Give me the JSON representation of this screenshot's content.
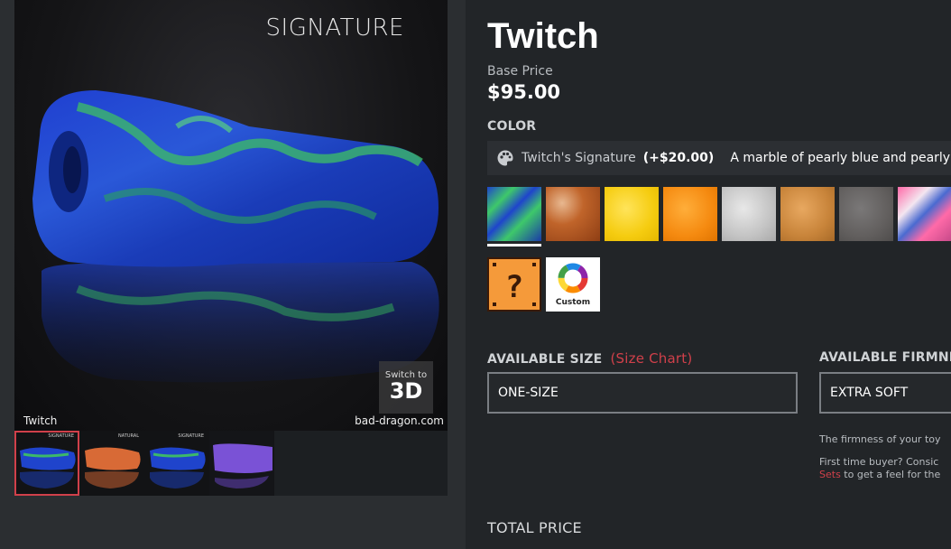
{
  "product": {
    "name": "Twitch",
    "base_price_label": "Base Price",
    "base_price": "$95.00"
  },
  "gallery": {
    "main_overlay_label": "SIGNATURE",
    "product_caption": "Twitch",
    "site_caption": "bad-dragon.com",
    "switch_small": "Switch to",
    "switch_big": "3D",
    "thumbnails": [
      {
        "label": "SIGNATURE",
        "active": true
      },
      {
        "label": "NATURAL",
        "active": false
      },
      {
        "label": "SIGNATURE",
        "active": false
      },
      {
        "label": "",
        "active": false
      }
    ]
  },
  "color": {
    "section_label": "COLOR",
    "selected_name": "Twitch's Signature",
    "selected_extra": "(+$20.00)",
    "selected_desc": "A marble of pearly blue and pearly g",
    "swatches": [
      "blue-green marble",
      "copper glitter",
      "yellow",
      "orange glitter",
      "silver glitter",
      "bronze glitter",
      "grey glitter",
      "pink-blue marble",
      "mystery block",
      "custom"
    ],
    "custom_label": "Custom",
    "mystery_glyph": "?"
  },
  "size": {
    "section_label": "AVAILABLE SIZE",
    "chart_link": "(Size Chart)",
    "value": "ONE-SIZE"
  },
  "firmness": {
    "section_label": "AVAILABLE FIRMNES",
    "value": "EXTRA SOFT",
    "note": "The firmness of your toy",
    "first_time_line1": "First time buyer? Consic",
    "first_time_link": "Sets",
    "first_time_line2": " to get a feel for the"
  },
  "total": {
    "label": "TOTAL PRICE"
  },
  "colors": {
    "accent_red": "#d0404a",
    "panel_dark": "#222528",
    "panel_left": "#2b2e31"
  }
}
